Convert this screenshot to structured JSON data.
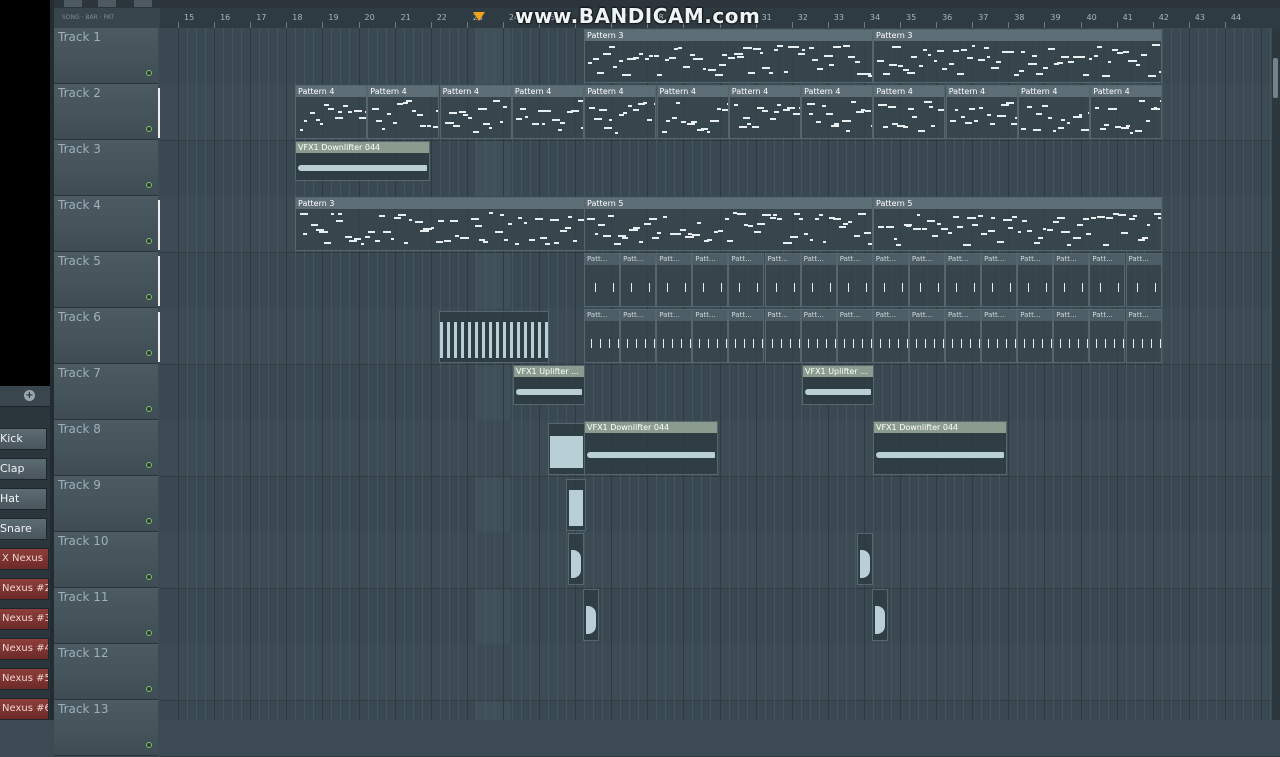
{
  "watermark": "www.BANDICAM.com",
  "snap_text": "SONG · BAR · PAT",
  "ruler": [
    "15",
    "16",
    "17",
    "18",
    "19",
    "20",
    "21",
    "22",
    "23",
    "24",
    "25",
    "26",
    "27",
    "28",
    "29",
    "30",
    "31",
    "32",
    "33",
    "34",
    "35",
    "36",
    "37",
    "38",
    "39",
    "40",
    "41",
    "42",
    "43",
    "44"
  ],
  "tracks": [
    {
      "label": "Track 1"
    },
    {
      "label": "Track 2"
    },
    {
      "label": "Track 3"
    },
    {
      "label": "Track 4"
    },
    {
      "label": "Track 5"
    },
    {
      "label": "Track 6"
    },
    {
      "label": "Track 7"
    },
    {
      "label": "Track 8"
    },
    {
      "label": "Track 9"
    },
    {
      "label": "Track 10"
    },
    {
      "label": "Track 11"
    },
    {
      "label": "Track 12"
    },
    {
      "label": "Track 13"
    }
  ],
  "channels": [
    {
      "label": "Kick",
      "color": "gray"
    },
    {
      "label": "Clap",
      "color": "gray"
    },
    {
      "label": "Hat",
      "color": "gray"
    },
    {
      "label": "Snare",
      "color": "gray"
    },
    {
      "label": "X Nexus",
      "color": "red"
    },
    {
      "label": "Nexus #2",
      "color": "red"
    },
    {
      "label": "Nexus #3",
      "color": "red"
    },
    {
      "label": "Nexus #4",
      "color": "red"
    },
    {
      "label": "Nexus #5",
      "color": "red"
    },
    {
      "label": "Nexus #6",
      "color": "red"
    }
  ],
  "clips": {
    "pattern3": "Pattern 3",
    "pattern4": "Pattern 4",
    "pattern5": "Pattern 5",
    "patt_short": "Patt...",
    "downlifter": "VFX1 Downlifter 044",
    "uplifter": "VFX1 Uplifter ..."
  },
  "colors": {
    "playhead": "#f4a11a",
    "led": "#7cc36b",
    "channel_red": "#8d3e3a"
  }
}
